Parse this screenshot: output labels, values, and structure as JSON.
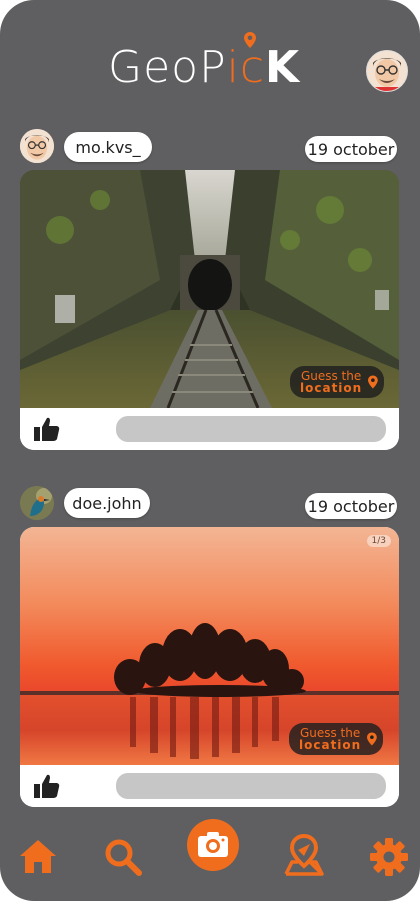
{
  "app": {
    "logo": {
      "part1": "GeoP",
      "part2": "ic",
      "part3": "K"
    },
    "brand_color": "#f06d1e",
    "bg_color": "#5f5f61"
  },
  "header": {
    "profile_icon": "user-avatar"
  },
  "posts": [
    {
      "username": "mo.kvs_",
      "date": "19 october",
      "image": "railway-tunnel-photo",
      "guess": {
        "line1": "Guess the",
        "line2": "location"
      },
      "like_icon": "thumbs-up-icon"
    },
    {
      "username": "doe.john",
      "date": "19 october",
      "image": "sunset-lake-island-photo",
      "counter": "1/3",
      "guess": {
        "line1": "Guess the",
        "line2": "location"
      },
      "like_icon": "thumbs-up-icon"
    }
  ],
  "bottom_nav": {
    "items": [
      "home-icon",
      "search-icon",
      "camera-icon",
      "map-pin-icon",
      "settings-icon"
    ]
  }
}
